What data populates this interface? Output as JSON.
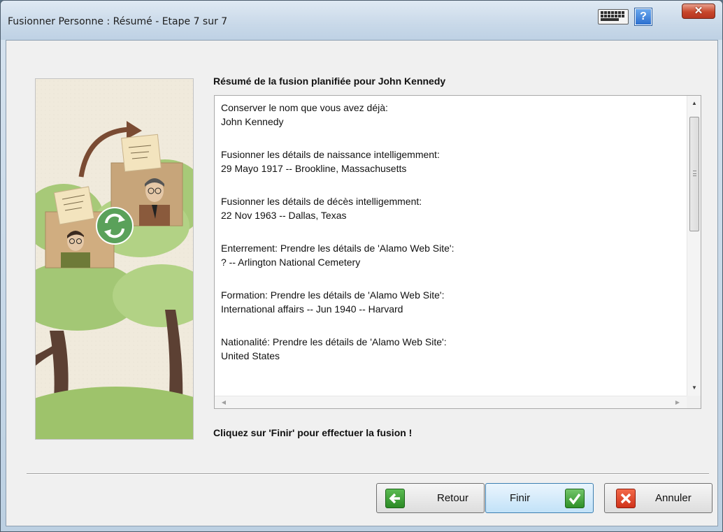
{
  "window": {
    "title": "Fusionner Personne : Résumé - Etape 7 sur 7",
    "close_glyph": "✕",
    "help_glyph": "?"
  },
  "summary": {
    "heading": "Résumé de la fusion planifiée pour John Kennedy",
    "items": [
      {
        "line1": "Conserver le nom que vous avez déjà:",
        "line2": "John Kennedy"
      },
      {
        "line1": "Fusionner les détails de naissance intelligemment:",
        "line2": "29 Mayo 1917 -- Brookline, Massachusetts"
      },
      {
        "line1": "Fusionner les détails de décès intelligemment:",
        "line2": "22 Nov 1963 -- Dallas, Texas"
      },
      {
        "line1": "Enterrement: Prendre les détails de 'Alamo Web Site':",
        "line2": "? -- Arlington National Cemetery"
      },
      {
        "line1": "Formation: Prendre les détails de 'Alamo Web Site':",
        "line2": "International affairs -- Jun 1940 -- Harvard"
      },
      {
        "line1": "Nationalité: Prendre les détails de 'Alamo Web Site':",
        "line2": "United States"
      }
    ],
    "finish_message": "Cliquez sur 'Finir' pour effectuer la fusion !"
  },
  "buttons": {
    "back": "Retour",
    "finish": "Finir",
    "cancel": "Annuler"
  },
  "colors": {
    "back_icon": "#2b8a25",
    "finish_icon": "#2e9028",
    "cancel_icon": "#d0321a",
    "finish_border": "#3c7fb1"
  }
}
